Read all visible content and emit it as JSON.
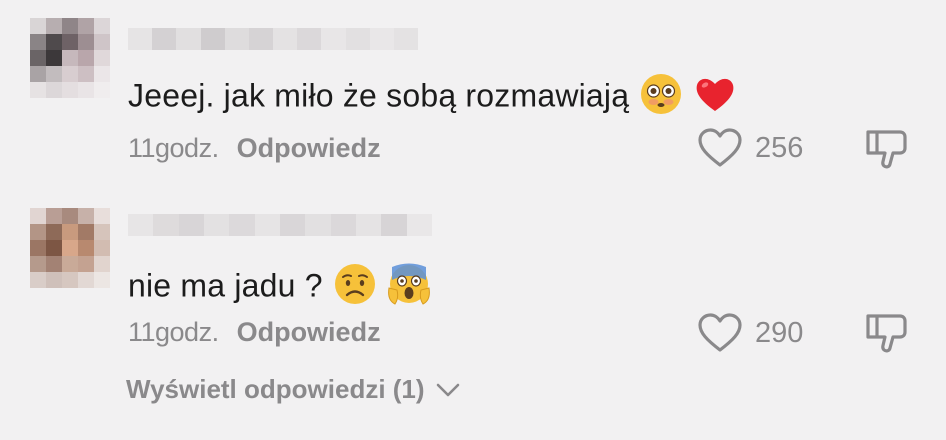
{
  "comments": [
    {
      "text": "Jeeej. jak miło że sobą rozmawiają",
      "emojis": [
        "flushed-face-emoji",
        "red-heart-emoji"
      ],
      "time": "11godz.",
      "reply_label": "Odpowiedz",
      "likes": "256"
    },
    {
      "text": "nie ma jadu ?",
      "emojis": [
        "worried-face-emoji",
        "screaming-face-emoji"
      ],
      "time": "11godz.",
      "reply_label": "Odpowiedz",
      "likes": "290"
    }
  ],
  "view_replies": {
    "label": "Wyświetl odpowiedzi (1)"
  },
  "colors": {
    "background": "#f2f1f2",
    "text": "#1c1c1c",
    "muted": "#8a898b",
    "heart_emoji": "#e8232e",
    "emoji_yellow": "#f6c13a"
  },
  "icons": {
    "like": "heart-outline-icon",
    "dislike": "thumbs-down-icon",
    "expand": "chevron-down-icon"
  }
}
